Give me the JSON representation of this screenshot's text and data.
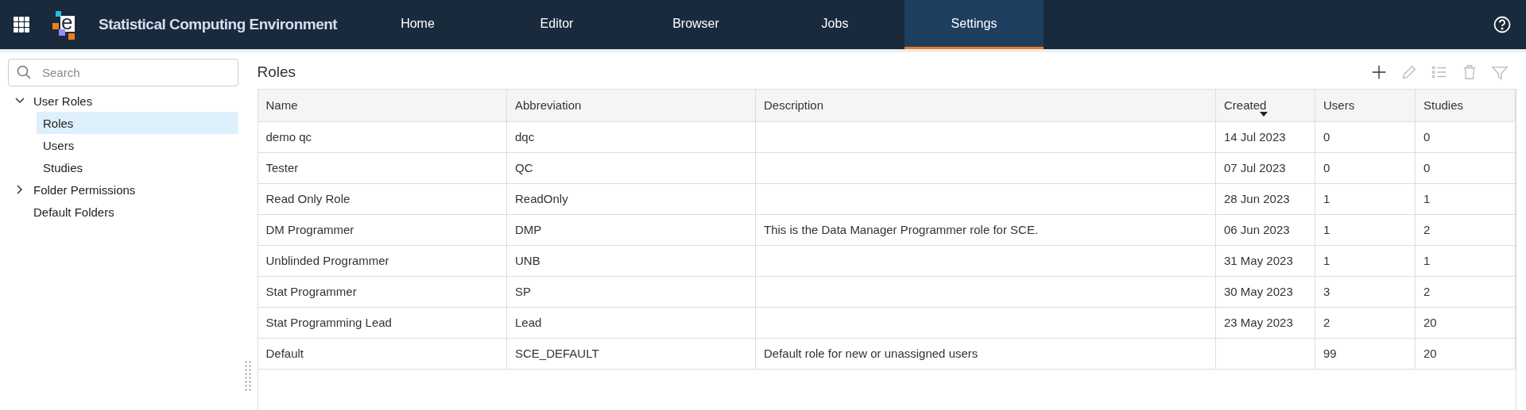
{
  "app": {
    "title": "Statistical Computing Environment",
    "logo_letter": "e"
  },
  "nav": [
    {
      "label": "Home",
      "selected": false
    },
    {
      "label": "Editor",
      "selected": false
    },
    {
      "label": "Browser",
      "selected": false
    },
    {
      "label": "Jobs",
      "selected": false
    },
    {
      "label": "Settings",
      "selected": true
    }
  ],
  "sidebar": {
    "search": {
      "placeholder": "Search"
    },
    "tree": [
      {
        "label": "User Roles",
        "expanded": true,
        "children": [
          {
            "label": "Roles",
            "selected": true
          },
          {
            "label": "Users",
            "selected": false
          },
          {
            "label": "Studies",
            "selected": false
          }
        ]
      },
      {
        "label": "Folder Permissions",
        "expanded": false
      },
      {
        "label": "Default Folders"
      }
    ]
  },
  "page": {
    "title": "Roles"
  },
  "toolbar": [
    {
      "kind": "add",
      "disabled": false
    },
    {
      "kind": "edit",
      "disabled": true
    },
    {
      "kind": "list",
      "disabled": true
    },
    {
      "kind": "delete",
      "disabled": true
    },
    {
      "kind": "filter",
      "disabled": true
    }
  ],
  "table": {
    "columns": [
      {
        "label": "Name",
        "sorted": false
      },
      {
        "label": "Abbreviation",
        "sorted": false
      },
      {
        "label": "Description",
        "sorted": false
      },
      {
        "label": "Created",
        "sorted": true
      },
      {
        "label": "Users",
        "sorted": false
      },
      {
        "label": "Studies",
        "sorted": false
      }
    ],
    "rows": [
      [
        "demo qc",
        "dqc",
        "",
        "14 Jul 2023",
        "0",
        "0"
      ],
      [
        "Tester",
        "QC",
        "",
        "07 Jul 2023",
        "0",
        "0"
      ],
      [
        "Read Only Role",
        "ReadOnly",
        "",
        "28 Jun 2023",
        "1",
        "1"
      ],
      [
        "DM Programmer",
        "DMP",
        "This is the Data Manager Programmer role for SCE.",
        "06 Jun 2023",
        "1",
        "2"
      ],
      [
        "Unblinded Programmer",
        "UNB",
        "",
        "31 May 2023",
        "1",
        "1"
      ],
      [
        "Stat Programmer",
        "SP",
        "",
        "30 May 2023",
        "3",
        "2"
      ],
      [
        "Stat Programming Lead",
        "Lead",
        "",
        "23 May 2023",
        "2",
        "20"
      ],
      [
        "Default",
        "SCE_DEFAULT",
        "Default role for new or unassigned users",
        "",
        "99",
        "20"
      ]
    ]
  }
}
